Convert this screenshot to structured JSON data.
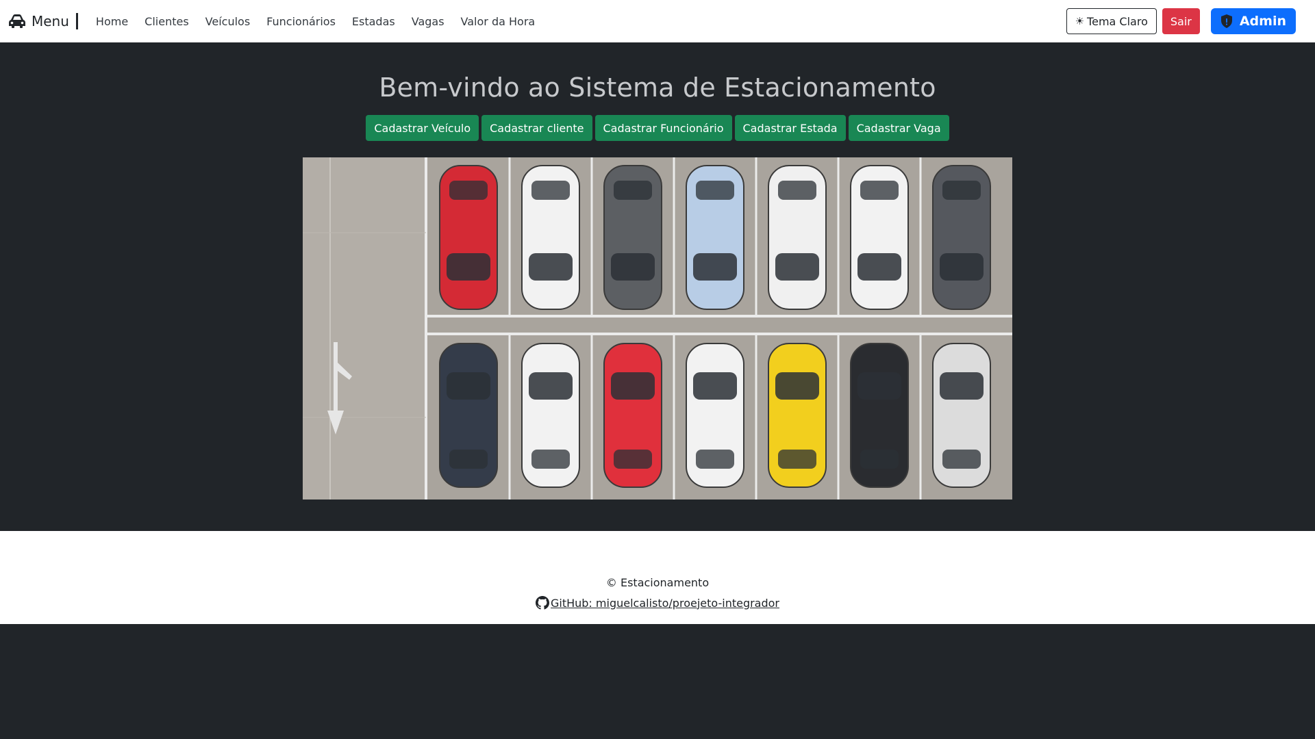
{
  "navbar": {
    "brand": "Menu",
    "links": [
      "Home",
      "Clientes",
      "Veículos",
      "Funcionários",
      "Estadas",
      "Vagas",
      "Valor da Hora"
    ],
    "theme_button": "Tema Claro",
    "logout_button": "Sair",
    "admin_button": "Admin"
  },
  "main": {
    "title": "Bem-vindo ao Sistema de Estacionamento",
    "actions": [
      "Cadastrar Veículo",
      "Cadastrar cliente",
      "Cadastrar Funcionário",
      "Cadastrar Estada",
      "Cadastrar Vaga"
    ]
  },
  "image": {
    "subject": "aerial-parking-lot",
    "top_row_car_colors": [
      "#d42a35",
      "#f2f2f2",
      "#5c5f63",
      "#b8cde6",
      "#f0f0f0",
      "#f2f2f2",
      "#55585e"
    ],
    "bottom_row_car_colors": [
      "#343c4a",
      "#f2f2f2",
      "#e0303c",
      "#f2f2f2",
      "#f2cf1e",
      "#2a2c30",
      "#dcdcdc"
    ]
  },
  "footer": {
    "copyright": "© Estacionamento",
    "github_link": "GitHub: miguelcalisto/proejeto-integrador"
  },
  "colors": {
    "primary": "#0d6efd",
    "danger": "#dc3545",
    "success": "#198754",
    "dark_bg": "#212529"
  }
}
